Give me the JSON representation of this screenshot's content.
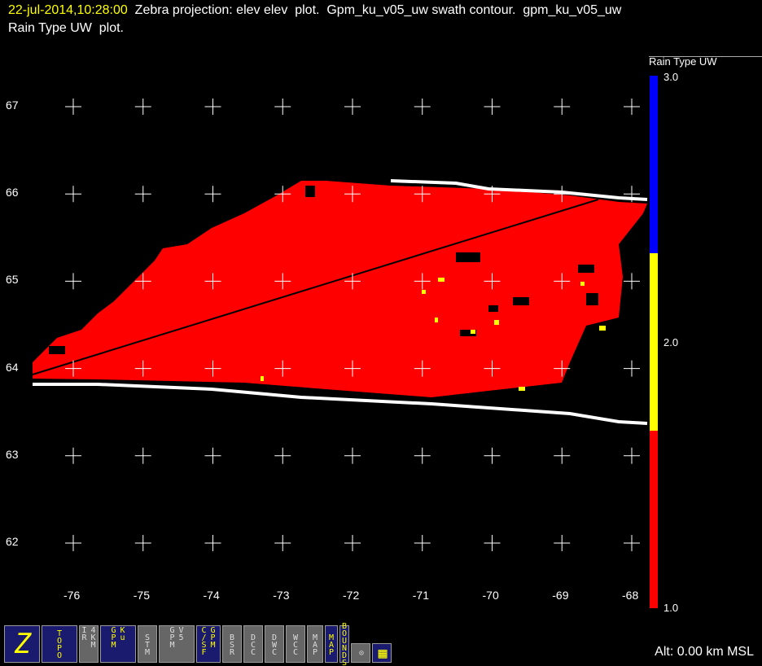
{
  "title": {
    "timestamp": "22-jul-2014,10:28:00",
    "line1": "  Zebra projection: elev elev  plot.  Gpm_ku_v05_uw swath contour.  gpm_ku_v05_uw",
    "line2": "Rain Type UW  plot."
  },
  "chart_data": {
    "type": "heatmap",
    "title": "Rain Type UW",
    "x_ticks": [
      "-76",
      "-75",
      "-74",
      "-73",
      "-72",
      "-71",
      "-70",
      "-69",
      "-68"
    ],
    "y_ticks": [
      "67",
      "66",
      "65",
      "64",
      "63",
      "62"
    ],
    "xlim": [
      -76,
      -68
    ],
    "ylim": [
      62,
      67
    ],
    "colorbar": {
      "title": "Rain Type UW",
      "labels": [
        "3.0",
        "2.0",
        "1.0"
      ],
      "range": [
        1.0,
        3.0
      ],
      "bands": [
        {
          "from": 1.0,
          "to": 1.67,
          "color": "#ff0000"
        },
        {
          "from": 1.67,
          "to": 2.33,
          "color": "#ffff00"
        },
        {
          "from": 2.33,
          "to": 3.0,
          "color": "#0000ff"
        }
      ]
    },
    "dominant_value": 1.0,
    "swath_color": "#ffffff",
    "track_color": "#000000"
  },
  "toolbar": [
    {
      "name": "zebra",
      "label": "Z"
    },
    {
      "name": "topo",
      "label": "TOPO"
    },
    {
      "name": "ir",
      "label": "IR 4KM"
    },
    {
      "name": "gpm-ku",
      "label": "GPM Ku"
    },
    {
      "name": "stm",
      "label": "STM"
    },
    {
      "name": "gpm-v5",
      "label": "GPM V5"
    },
    {
      "name": "csf-gpm",
      "label": "C/SF GPM"
    },
    {
      "name": "bsr",
      "label": "BSR"
    },
    {
      "name": "dcc",
      "label": "DCC"
    },
    {
      "name": "dwc",
      "label": "DWC"
    },
    {
      "name": "wcc",
      "label": "WCC"
    },
    {
      "name": "map",
      "label": "MAP"
    },
    {
      "name": "map2",
      "label": "MAP"
    },
    {
      "name": "bounds",
      "label": "BOUNDS"
    }
  ],
  "altitude": "Alt: 0.00 km MSL"
}
